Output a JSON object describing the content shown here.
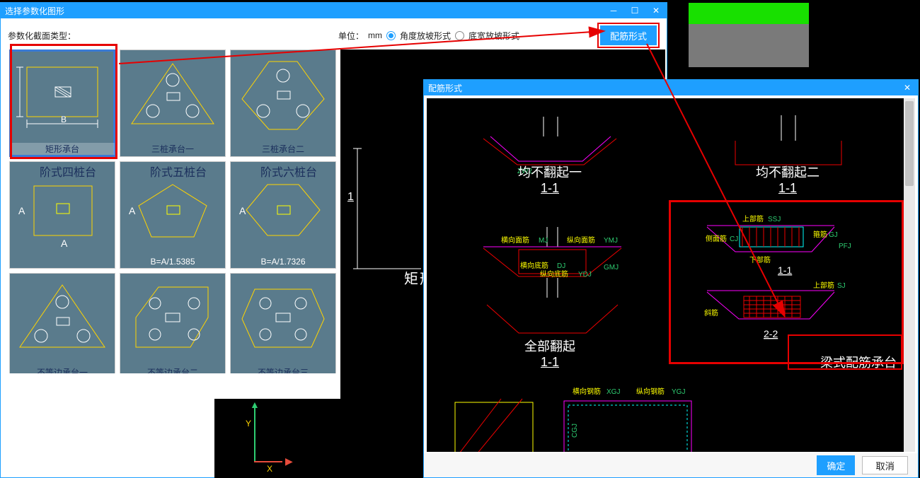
{
  "main_dialog": {
    "title": "选择参数化图形",
    "type_label": "参数化截面类型：",
    "unit_prefix": "单位：",
    "unit_value": "mm",
    "radio1": "角度放坡形式",
    "radio2": "底宽放坡形式",
    "jin_button": "配筋形式",
    "thumbs": [
      {
        "caption": "矩形承台",
        "topline": "B"
      },
      {
        "caption": "三桩承台一"
      },
      {
        "caption": "三桩承台二"
      },
      {
        "caption": "阶式四桩台",
        "sideA": "A",
        "botA": "A"
      },
      {
        "caption": "阶式五桩台",
        "sideA": "A",
        "formula": "B=A/1.5385"
      },
      {
        "caption": "阶式六桩台",
        "sideA": "A",
        "formula": "B=A/1.7326"
      },
      {
        "caption": "不等边承台一"
      },
      {
        "caption": "不等边承台二"
      },
      {
        "caption": "不等边承台三"
      }
    ]
  },
  "preview": {
    "h_label": "1",
    "title": "矩形"
  },
  "rebar_dialog": {
    "title": "配筋形式",
    "ok": "确定",
    "cancel": "取消",
    "cells": [
      {
        "cap1": "均不翻起一",
        "cap2": "1-1",
        "tag": "ZW2"
      },
      {
        "cap1": "均不翻起二",
        "cap2": "1-1"
      },
      {
        "cap1": "全部翻起",
        "cap2": "1-1",
        "labels": {
          "hg": "横向面筋MJ",
          "zg": "纵向面筋YMJ",
          "hd": "横向底筋DJ",
          "zd": "纵向底筋YDJ",
          "gmj": "GMJ"
        }
      },
      {
        "cap1": "梁式配筋承台",
        "cap2a": "1-1",
        "cap2b": "2-2",
        "labels": {
          "top": "上部筋SSJ",
          "side": "侧面筋CJ",
          "gj": "箍筋GJ",
          "pfj": "PFJ",
          "bot": "下部筋"
        }
      },
      {
        "labels": {
          "h": "横向钢筋XGJ",
          "z": "纵向钢筋YGJ",
          "cgj": "CGJ"
        }
      }
    ]
  },
  "cad": {
    "Y": "Y",
    "X": "X",
    "yarrow": "▲",
    "xarrow": "▶"
  }
}
